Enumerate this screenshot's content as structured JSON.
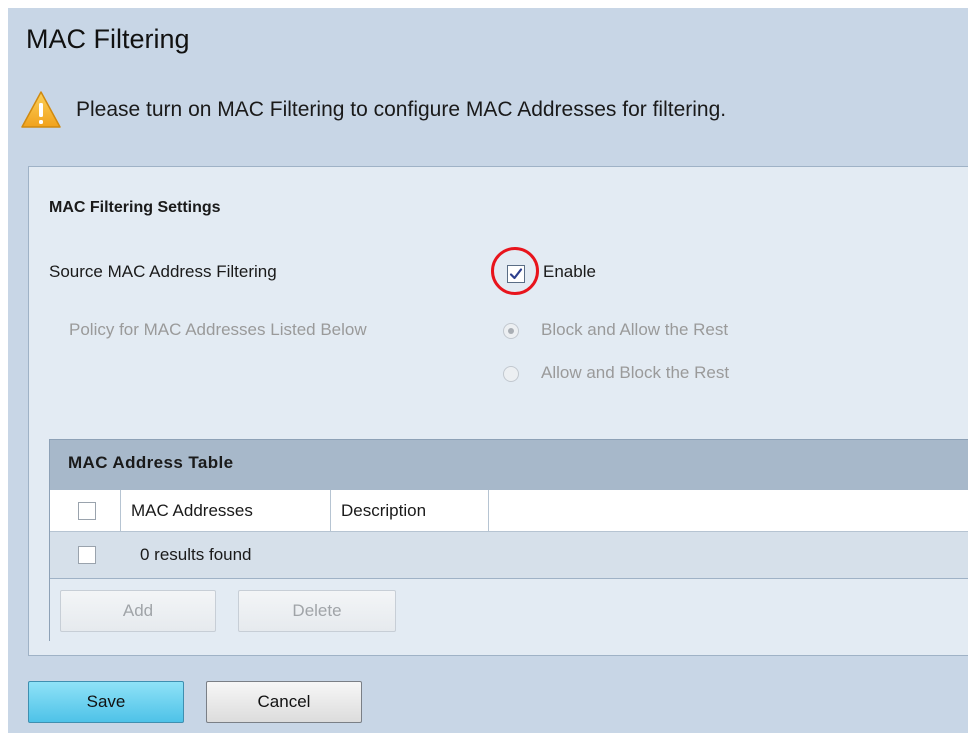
{
  "page": {
    "title": "MAC Filtering"
  },
  "warning": {
    "icon": "warning-triangle-icon",
    "message": "Please turn on MAC Filtering to configure MAC Addresses for filtering."
  },
  "settings": {
    "heading": "MAC Filtering Settings",
    "source_filter": {
      "label": "Source MAC Address Filtering",
      "checkbox_label": "Enable",
      "checked": true
    },
    "policy": {
      "label": "Policy for MAC Addresses Listed Below",
      "options": [
        {
          "label": "Block and Allow the Rest",
          "selected": true
        },
        {
          "label": "Allow and Block the Rest",
          "selected": false
        }
      ]
    }
  },
  "table": {
    "caption": "MAC Address Table",
    "columns": [
      "MAC Addresses",
      "Description"
    ],
    "empty_message": "0 results found",
    "add_label": "Add",
    "delete_label": "Delete"
  },
  "actions": {
    "save_label": "Save",
    "cancel_label": "Cancel"
  },
  "colors": {
    "page_background": "#c8d6e6",
    "highlight_ring": "#e8141c",
    "save_button": "#4ec2e8",
    "warning_icon": "#f5b32a"
  }
}
